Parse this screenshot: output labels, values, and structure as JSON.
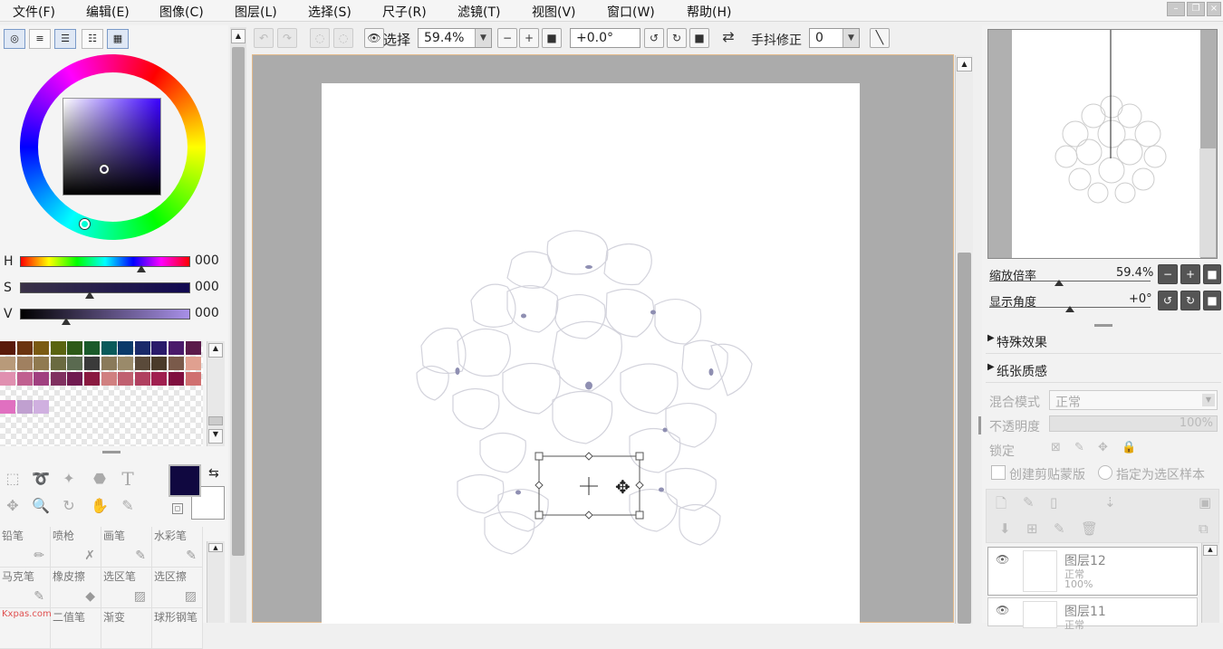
{
  "menu": [
    "文件(F)",
    "编辑(E)",
    "图像(C)",
    "图层(L)",
    "选择(S)",
    "尺子(R)",
    "滤镜(T)",
    "视图(V)",
    "窗口(W)",
    "帮助(H)"
  ],
  "toolbar": {
    "select_label": "选择",
    "zoom_value": "59.4%",
    "rotation_value": "+0.0°",
    "stabilizer_label": "手抖修正",
    "stabilizer_value": "0"
  },
  "color_panel": {
    "hsv": [
      {
        "letter": "H",
        "value": "000"
      },
      {
        "letter": "S",
        "value": "000"
      },
      {
        "letter": "V",
        "value": "000"
      }
    ],
    "foreground_color": "#100840",
    "background_color": "#ffffff",
    "swatches_row1": [
      "#5a1a0a",
      "#6b3410",
      "#7a5a12",
      "#5a6410",
      "#2e5a18",
      "#1a5a2a",
      "#0a5a5a",
      "#0a3a6a",
      "#1a2a6a",
      "#2a1a6a",
      "#4a1a6a",
      "#5a1a4a"
    ],
    "swatches_row2": [
      "#b89a7a",
      "#a08060",
      "#907a50",
      "#6a6a40",
      "#5a6a50",
      "#3a3a3a",
      "#8a7a5a",
      "#9a8a6a",
      "#5a4a3a",
      "#4a3a2a",
      "#7a5a4a",
      "#e0a090"
    ],
    "swatches_row3": [
      "#e090b0",
      "#c06090",
      "#a04080",
      "#803060",
      "#701a50",
      "#8a1a40",
      "#d08080",
      "#c06070",
      "#b04060",
      "#a02050",
      "#801040",
      "#d07070"
    ],
    "swatches_row4": [
      "#e070c0",
      "#c0a0d0",
      "#d0b0e0"
    ]
  },
  "brushes": [
    {
      "name": "铅笔"
    },
    {
      "name": "喷枪"
    },
    {
      "name": "画笔"
    },
    {
      "name": "水彩笔"
    },
    {
      "name": "马克笔"
    },
    {
      "name": "橡皮擦"
    },
    {
      "name": "选区笔"
    },
    {
      "name": "选区擦"
    },
    {
      "name": "Kxpas.com"
    },
    {
      "name": "二值笔"
    },
    {
      "name": "渐变"
    },
    {
      "name": "球形钢笔"
    }
  ],
  "right_panel": {
    "zoom_label": "缩放倍率",
    "zoom_value": "59.4%",
    "angle_label": "显示角度",
    "angle_value": "+0°",
    "special_effects": "特殊效果",
    "paper_texture": "纸张质感",
    "blend_mode_label": "混合模式",
    "blend_mode_value": "正常",
    "opacity_label": "不透明度",
    "opacity_value": "100%",
    "lock_label": "锁定",
    "clip_label": "创建剪贴蒙版",
    "select_source_label": "指定为选区样本",
    "layers": [
      {
        "name": "图层12",
        "mode": "正常",
        "opacity": "100%"
      },
      {
        "name": "图层11",
        "mode": "正常",
        "opacity": ""
      }
    ]
  }
}
